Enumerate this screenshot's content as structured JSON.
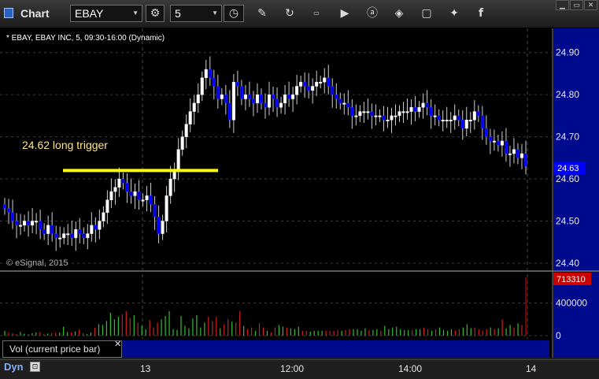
{
  "app": {
    "title": "Chart"
  },
  "toolbar": {
    "symbol": "EBAY",
    "interval": "5",
    "icons": [
      "settings-icon",
      "clock-icon",
      "draw-icon",
      "refresh-icon",
      "get-icon",
      "play-icon",
      "alert-icon",
      "tag-icon",
      "chat-icon",
      "twitter-icon",
      "facebook-icon"
    ]
  },
  "window_controls": [
    "minimize",
    "maximize",
    "close"
  ],
  "chart": {
    "header": "* EBAY, EBAY INC, 5, 09:30-16:00 (Dynamic)",
    "watermark": "© eSignal, 2015",
    "annotation": "24.62 long trigger",
    "current_price": "24.63",
    "volume_label": "Vol (current price bar)",
    "current_volume": "713310",
    "colors": {
      "up": "#ffffff",
      "down": "#0000ff",
      "trigger": "#ffff00",
      "annotation_text": "#ffe58a",
      "axis_bg": "#000a8c",
      "price_tag": "#0000ff",
      "volume_tag": "#cc0000"
    }
  },
  "bottom": {
    "mode": "Dyn",
    "x_ticks": [
      "13",
      "12:00",
      "14:00",
      "14"
    ]
  },
  "chart_data": [
    {
      "type": "candlestick",
      "title": "* EBAY, EBAY INC, 5, 09:30-16:00 (Dynamic)",
      "y_ticks": [
        "24.90",
        "24.80",
        "24.70",
        "24.60",
        "24.50",
        "24.40"
      ],
      "ylim": [
        24.385,
        24.95
      ],
      "x_ticks": [
        "13",
        "12:00",
        "14:00",
        "14"
      ],
      "grid": true,
      "trigger_level": 24.62,
      "last_price": 24.63,
      "closes": [
        24.53,
        24.52,
        24.5,
        24.49,
        24.49,
        24.5,
        24.49,
        24.5,
        24.5,
        24.48,
        24.47,
        24.49,
        24.47,
        24.46,
        24.46,
        24.47,
        24.47,
        24.46,
        24.48,
        24.47,
        24.46,
        24.47,
        24.49,
        24.48,
        24.5,
        24.52,
        24.55,
        24.57,
        24.58,
        24.6,
        24.59,
        24.57,
        24.56,
        24.57,
        24.55,
        24.55,
        24.56,
        24.54,
        24.51,
        24.47,
        24.5,
        24.56,
        24.6,
        24.62,
        24.67,
        24.7,
        24.73,
        24.76,
        24.78,
        24.8,
        24.84,
        24.86,
        24.84,
        24.82,
        24.79,
        24.8,
        24.78,
        24.74,
        24.83,
        24.82,
        24.79,
        24.8,
        24.79,
        24.78,
        24.8,
        24.78,
        24.77,
        24.8,
        24.79,
        24.77,
        24.78,
        24.8,
        24.79,
        24.8,
        24.82,
        24.83,
        24.82,
        24.81,
        24.82,
        24.83,
        24.83,
        24.84,
        24.82,
        24.8,
        24.79,
        24.78,
        24.78,
        24.77,
        24.75,
        24.75,
        24.76,
        24.76,
        24.76,
        24.75,
        24.75,
        24.75,
        24.74,
        24.74,
        24.75,
        24.75,
        24.76,
        24.76,
        24.76,
        24.77,
        24.76,
        24.77,
        24.78,
        24.77,
        24.75,
        24.75,
        24.74,
        24.74,
        24.74,
        24.74,
        24.75,
        24.74,
        24.72,
        24.74,
        24.74,
        24.76,
        24.75,
        24.72,
        24.7,
        24.69,
        24.69,
        24.68,
        24.69,
        24.66,
        24.66,
        24.67,
        24.65,
        24.66,
        24.63
      ]
    },
    {
      "type": "bar",
      "title": "Vol (current price bar)",
      "y_ticks": [
        "400000",
        "0"
      ],
      "ylim": [
        0,
        713310
      ],
      "last_value": 713310,
      "values": [
        60000,
        40000,
        30000,
        20000,
        45000,
        25000,
        20000,
        30000,
        40000,
        45000,
        20000,
        25000,
        30000,
        35000,
        40000,
        110000,
        45000,
        40000,
        50000,
        75000,
        30000,
        20000,
        40000,
        95000,
        140000,
        130000,
        180000,
        280000,
        200000,
        230000,
        260000,
        300000,
        220000,
        250000,
        160000,
        120000,
        80000,
        190000,
        100000,
        160000,
        200000,
        240000,
        300000,
        80000,
        70000,
        240000,
        120000,
        90000,
        210000,
        250000,
        100000,
        160000,
        230000,
        180000,
        230000,
        90000,
        140000,
        200000,
        170000,
        160000,
        300000,
        120000,
        80000,
        100000,
        60000,
        150000,
        100000,
        60000,
        40000,
        100000,
        130000,
        110000,
        100000,
        90000,
        80000,
        110000,
        60000,
        60000,
        50000,
        60000,
        60000,
        60000,
        60000,
        60000,
        60000,
        70000,
        60000,
        70000,
        80000,
        80000,
        80000,
        60000,
        90000,
        70000,
        70000,
        80000,
        60000,
        120000,
        80000,
        100000,
        110000,
        80000,
        70000,
        70000,
        70000,
        80000,
        80000,
        100000,
        80000,
        60000,
        80000,
        100000,
        70000,
        60000,
        80000,
        60000,
        80000,
        100000,
        140000,
        90000,
        100000,
        80000,
        60000,
        80000,
        100000,
        80000,
        90000,
        200000,
        90000,
        130000,
        100000,
        150000,
        130000,
        713310
      ]
    }
  ]
}
